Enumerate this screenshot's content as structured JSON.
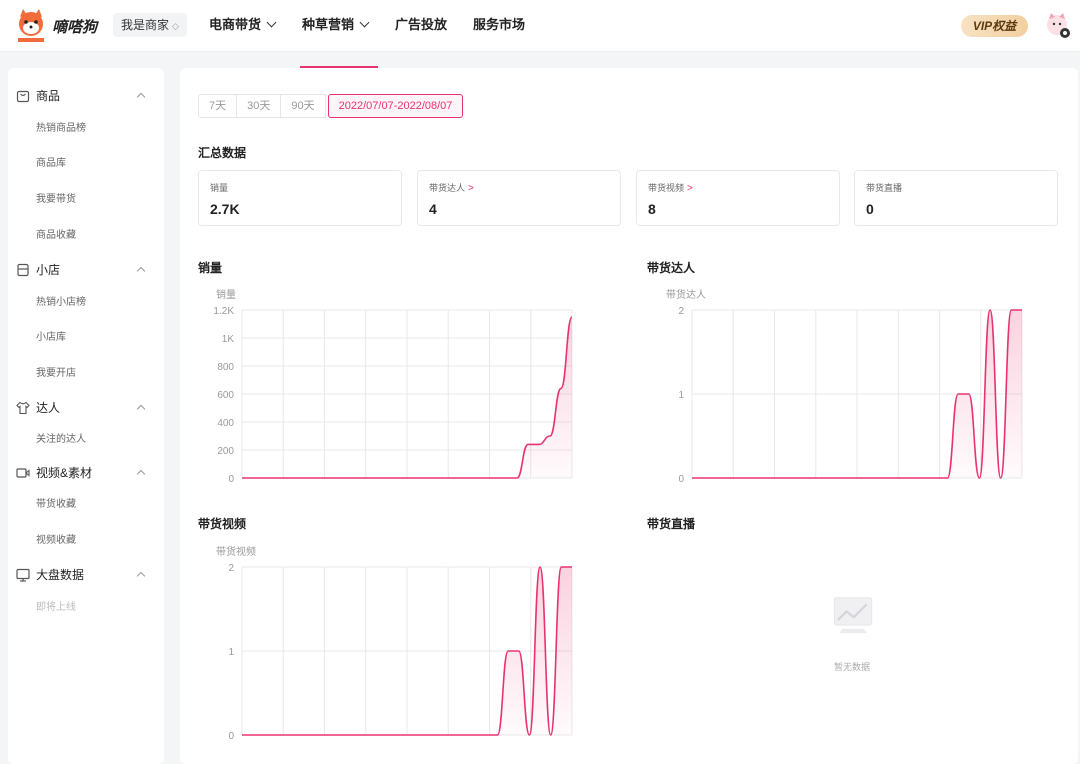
{
  "header": {
    "brand": "嘀嗒狗",
    "role": "我是商家",
    "nav": [
      {
        "label": "电商带货",
        "has_menu": true
      },
      {
        "label": "种草营销",
        "has_menu": true
      },
      {
        "label": "广告投放",
        "has_menu": false
      },
      {
        "label": "服务市场",
        "has_menu": false
      }
    ],
    "vip": "VIP权益"
  },
  "sidebar": {
    "sections": [
      {
        "label": "商品",
        "icon": "shopping-bag-icon",
        "items": [
          {
            "label": "热销商品榜"
          },
          {
            "label": "商品库"
          },
          {
            "label": "我要带货"
          },
          {
            "label": "商品收藏"
          }
        ]
      },
      {
        "label": "小店",
        "icon": "store-icon",
        "items": [
          {
            "label": "热销小店榜"
          },
          {
            "label": "小店库"
          },
          {
            "label": "我要开店"
          }
        ]
      },
      {
        "label": "达人",
        "icon": "shirt-icon",
        "items": [
          {
            "label": "关注的达人"
          }
        ]
      },
      {
        "label": "视频&素材",
        "icon": "video-icon",
        "items": [
          {
            "label": "带货收藏"
          },
          {
            "label": "视频收藏"
          }
        ]
      },
      {
        "label": "大盘数据",
        "icon": "dashboard-icon",
        "items": [
          {
            "label": "即将上线"
          }
        ]
      }
    ]
  },
  "date_tabs": [
    "7天",
    "30天",
    "90天",
    "2022/07/07-2022/08/07"
  ],
  "summary": {
    "title": "汇总数据",
    "cards": [
      {
        "label": "销量",
        "value": "2.7K",
        "link": false
      },
      {
        "label": "带货达人",
        "value": "4",
        "link": true
      },
      {
        "label": "带货视频",
        "value": "8",
        "link": true
      },
      {
        "label": "带货直播",
        "value": "0",
        "link": false
      }
    ],
    "link_glyph": ">"
  },
  "empty_text": "暂无数据",
  "colors": {
    "accent": "#e8336d",
    "grid": "#e8e8ec"
  },
  "chart_data": [
    {
      "type": "area",
      "title": "销量",
      "ylabel": "销量",
      "ylim": [
        0,
        1200
      ],
      "yticks": [
        "0",
        "200",
        "400",
        "600",
        "800",
        "1K",
        "1.2K"
      ],
      "ytick_values": [
        0,
        200,
        400,
        600,
        800,
        1000,
        1200
      ],
      "grid": true,
      "series": [
        {
          "values": [
            0,
            0,
            0,
            0,
            0,
            0,
            0,
            0,
            0,
            0,
            0,
            0,
            0,
            0,
            0,
            0,
            0,
            0,
            0,
            0,
            0,
            0,
            0,
            0,
            0,
            0,
            240,
            240,
            300,
            640,
            1150
          ]
        }
      ]
    },
    {
      "type": "area",
      "title": "带货达人",
      "ylabel": "带货达人",
      "ylim": [
        0,
        2
      ],
      "yticks": [
        "0",
        "1",
        "2"
      ],
      "ytick_values": [
        0,
        1,
        2
      ],
      "grid": true,
      "series": [
        {
          "values": [
            0,
            0,
            0,
            0,
            0,
            0,
            0,
            0,
            0,
            0,
            0,
            0,
            0,
            0,
            0,
            0,
            0,
            0,
            0,
            0,
            0,
            0,
            0,
            0,
            0,
            1,
            1,
            0,
            2,
            0,
            2,
            2
          ]
        }
      ]
    },
    {
      "type": "area",
      "title": "带货视频",
      "ylabel": "带货视频",
      "ylim": [
        0,
        2
      ],
      "yticks": [
        "0",
        "1",
        "2"
      ],
      "ytick_values": [
        0,
        1,
        2
      ],
      "grid": true,
      "series": [
        {
          "values": [
            0,
            0,
            0,
            0,
            0,
            0,
            0,
            0,
            0,
            0,
            0,
            0,
            0,
            0,
            0,
            0,
            0,
            0,
            0,
            0,
            0,
            0,
            0,
            0,
            0,
            1,
            1,
            0,
            2,
            0,
            2,
            2
          ]
        }
      ]
    },
    {
      "type": "area",
      "title": "带货直播",
      "series": []
    }
  ]
}
